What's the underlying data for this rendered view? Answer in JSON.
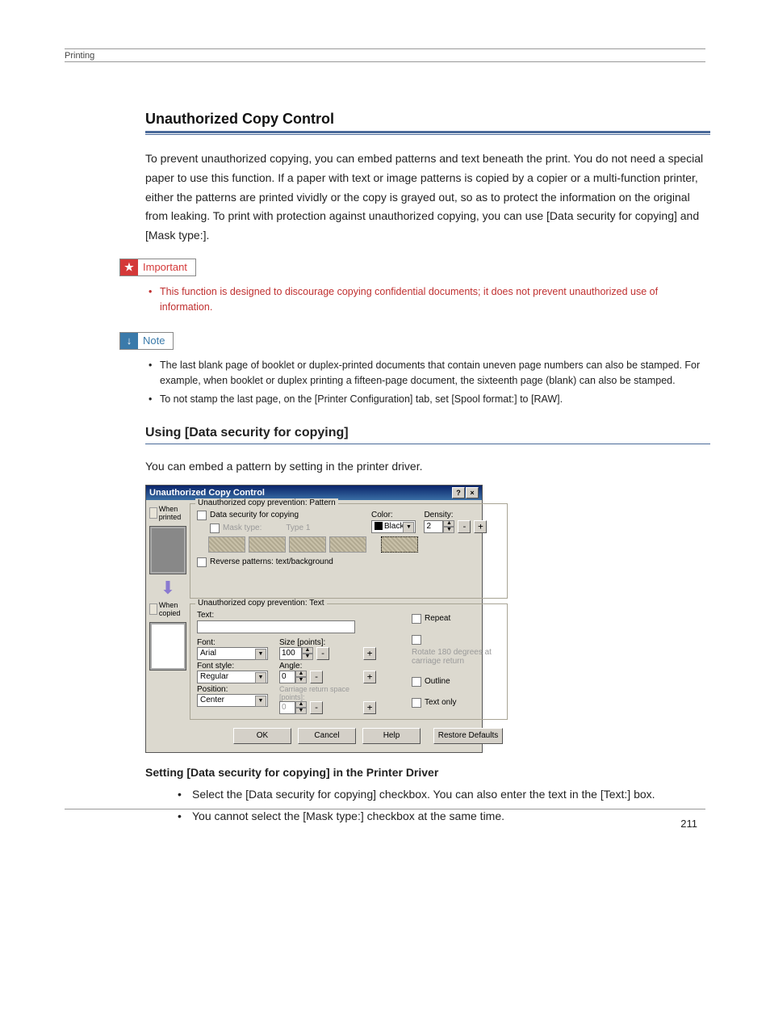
{
  "header": {
    "section": "Printing"
  },
  "page_number": "211",
  "main": {
    "title": "Unauthorized Copy Control",
    "intro": "To prevent unauthorized copying, you can embed patterns and text beneath the print. You do not need a special paper to use this function. If a paper with text or image patterns is copied by a copier or a multi-function printer, either the patterns are printed vividly or the copy is grayed out, so as to protect the information on the original from leaking. To print with protection against unauthorized copying, you can use [Data security for copying] and [Mask type:].",
    "important_label": "Important",
    "important_bullets": [
      "This function is designed to discourage copying confidential documents; it does not prevent unauthorized use of information."
    ],
    "note_label": "Note",
    "note_bullets": [
      "The last blank page of booklet or duplex-printed documents that contain uneven page numbers can also be stamped. For example, when booklet or duplex printing a fifteen-page document, the sixteenth page (blank) can also be stamped.",
      "To not stamp the last page, on the [Printer Configuration] tab, set [Spool format:] to [RAW]."
    ],
    "sub_title": "Using [Data security for copying]",
    "sub_intro": "You can embed a pattern by setting in the printer driver.",
    "driver_title": "Setting [Data security for copying] in the Printer Driver",
    "driver_bullets": [
      "Select the [Data security for copying] checkbox. You can also enter the text in the [Text:] box.",
      "You cannot select the [Mask type:] checkbox at the same time."
    ]
  },
  "dialog": {
    "title": "Unauthorized Copy Control",
    "preview": {
      "when_printed": "When printed",
      "when_copied": "When copied"
    },
    "pattern_group": {
      "legend": "Unauthorized copy prevention: Pattern",
      "data_security": "Data security for copying",
      "mask_type_label": "Mask type:",
      "mask_type_value": "Type 1",
      "color_label": "Color:",
      "color_value": "Black",
      "density_label": "Density:",
      "density_value": "2",
      "reverse": "Reverse patterns: text/background"
    },
    "text_group": {
      "legend": "Unauthorized copy prevention: Text",
      "text_label": "Text:",
      "font_label": "Font:",
      "font_value": "Arial",
      "size_label": "Size [points]:",
      "size_value": "100",
      "font_style_label": "Font style:",
      "font_style_value": "Regular",
      "angle_label": "Angle:",
      "angle_value": "0",
      "position_label": "Position:",
      "position_value": "Center",
      "crspace_label": "Carriage return space [points]:",
      "crspace_value": "0",
      "repeat": "Repeat",
      "rotate": "Rotate 180 degrees at carriage return",
      "outline": "Outline",
      "text_only": "Text only"
    },
    "buttons": {
      "ok": "OK",
      "cancel": "Cancel",
      "help": "Help",
      "restore": "Restore Defaults"
    }
  }
}
